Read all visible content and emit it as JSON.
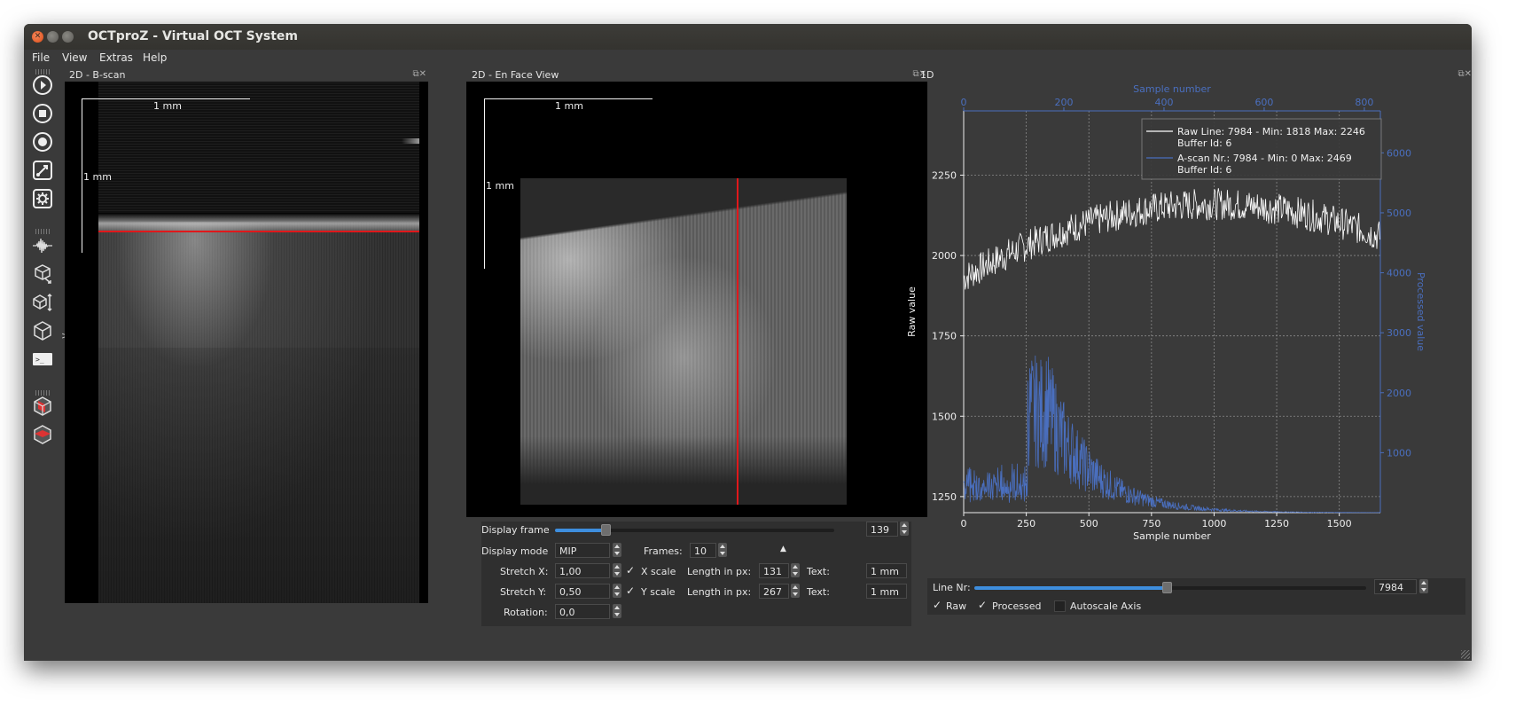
{
  "window": {
    "title": "OCTproZ - Virtual OCT System"
  },
  "menu": {
    "items": [
      "File",
      "View",
      "Extras",
      "Help"
    ]
  },
  "toolbar": {
    "icons": [
      "play-icon",
      "stop-icon",
      "record-icon",
      "plugin-icon",
      "settings-icon",
      "waveform-icon",
      "volume-export-icon",
      "volume-resize-icon",
      "cube-icon",
      "console-icon",
      "cube-red-icon",
      "cube-slice-icon"
    ]
  },
  "bscan": {
    "title": "2D - B-scan",
    "scale_h": "1 mm",
    "scale_v": "1 mm"
  },
  "enface": {
    "title": "2D - En Face View",
    "scale_h": "1 mm",
    "scale_v": "1 mm",
    "display_frame_label": "Display frame",
    "display_frame_value": "139",
    "display_frame_fraction": 0.18,
    "display_mode_label": "Display mode",
    "display_mode_value": "MIP",
    "frames_label": "Frames:",
    "frames_value": "10",
    "stretch_x_label": "Stretch X:",
    "stretch_x_value": "1,00",
    "stretch_y_label": "Stretch Y:",
    "stretch_y_value": "0,50",
    "rotation_label": "Rotation:",
    "rotation_value": "0,0",
    "x_scale_label": "X scale",
    "y_scale_label": "Y scale",
    "length_px_label": "Length in px:",
    "length_x_value": "131",
    "length_y_value": "267",
    "text_label": "Text:",
    "text_x_value": "1 mm",
    "text_y_value": "1 mm"
  },
  "one_d": {
    "title": "1D",
    "line_nr_label": "Line Nr:",
    "line_nr_value": "7984",
    "line_nr_fraction": 0.49,
    "raw_label": "Raw",
    "processed_label": "Processed",
    "autoscale_label": "Autoscale Axis"
  },
  "chart_data": {
    "type": "line",
    "xlabel": "Sample number",
    "x2label": "Sample number",
    "ylabel": "Raw value",
    "y2label": "Processed value",
    "xlim": [
      0,
      1664
    ],
    "x2lim": [
      0,
      832
    ],
    "ylim": [
      1200,
      2450
    ],
    "y2lim": [
      0,
      6700
    ],
    "xticks": [
      0,
      250,
      500,
      750,
      1000,
      1250,
      1500
    ],
    "x2ticks": [
      0,
      200,
      400,
      600,
      800
    ],
    "yticks": [
      1250,
      1500,
      1750,
      2000,
      2250
    ],
    "y2ticks": [
      1000,
      2000,
      3000,
      4000,
      5000,
      6000
    ],
    "grid": true,
    "legend": {
      "position": "top-right",
      "entries": [
        {
          "line1": "Raw Line: 7984 - Min: 1818   Max: 2246",
          "line2": "Buffer Id: 6",
          "color": "#ffffff"
        },
        {
          "line1": "A-scan Nr.: 7984 - Min: 0   Max: 2469",
          "line2": "Buffer Id: 6",
          "color": "#4a6fbf"
        }
      ]
    },
    "series": [
      {
        "name": "Raw Line",
        "axis": "left",
        "color": "#ffffff",
        "min": 1818,
        "max": 2246
      },
      {
        "name": "A-scan",
        "axis": "right",
        "color": "#4a6fbf",
        "min": 0,
        "max": 2469
      }
    ]
  },
  "colors": {
    "accent": "#3e8ede",
    "red_marker": "#e0181b",
    "axis_blue": "#4a6fbf"
  }
}
